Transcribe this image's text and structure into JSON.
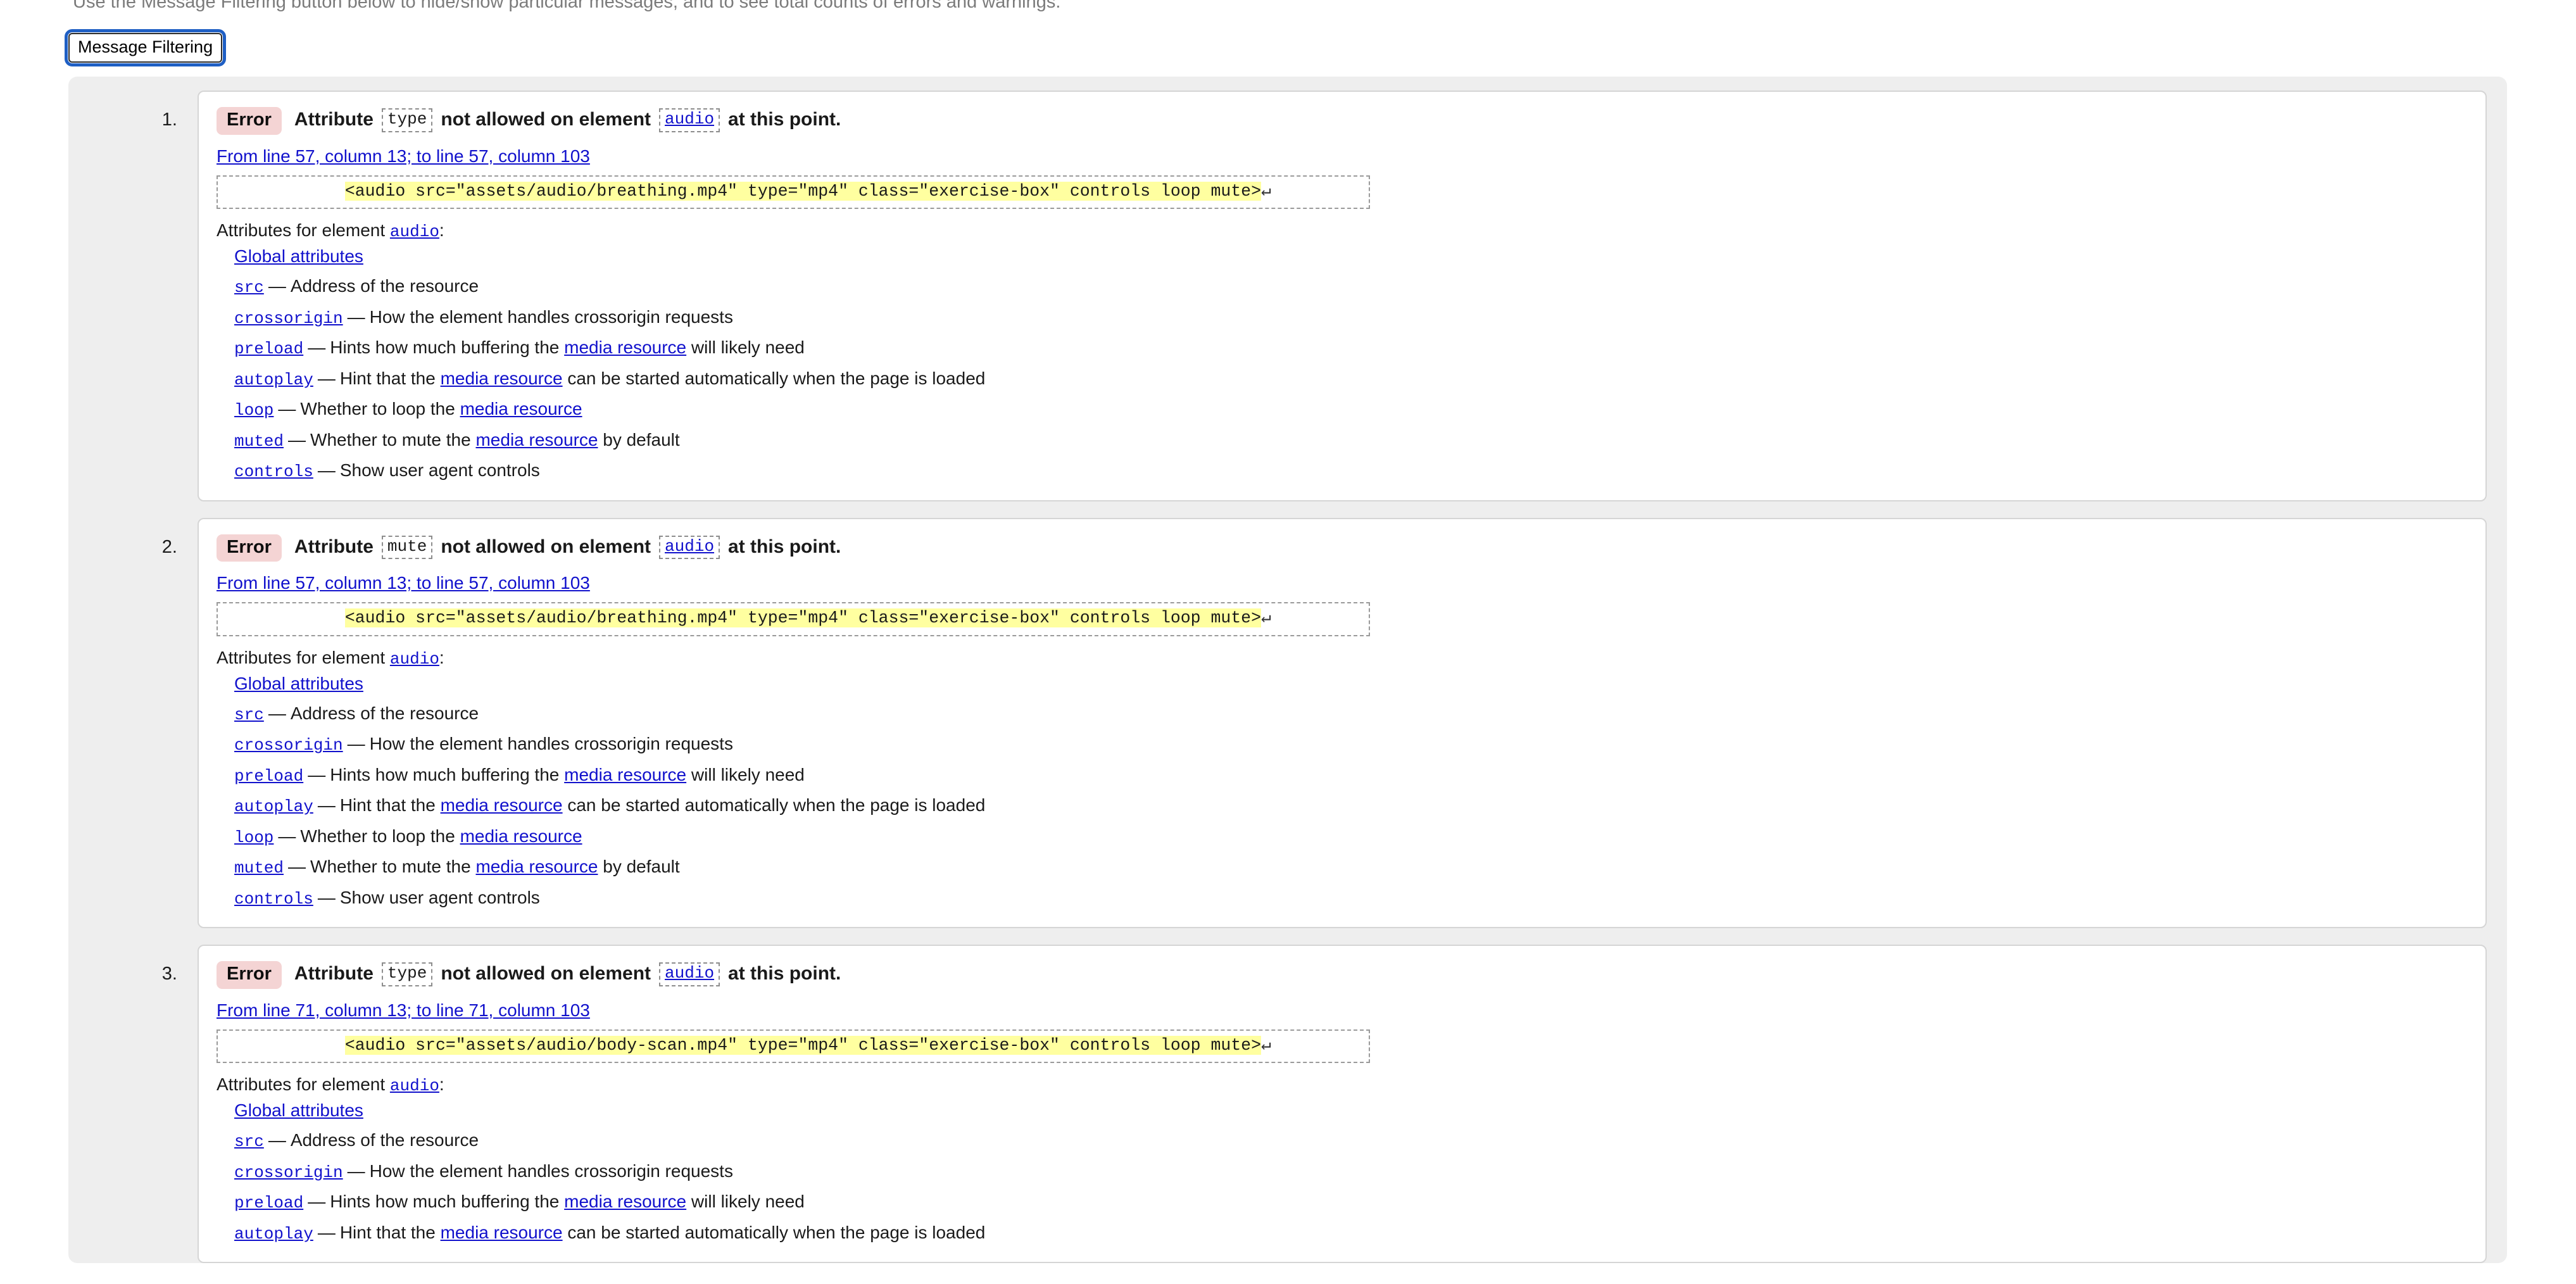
{
  "intro": {
    "text": "Use the Message Filtering button below to hide/show particular messages, and to see total counts of errors and warnings."
  },
  "toolbar": {
    "filter_button_label": "Message Filtering"
  },
  "labels": {
    "badge_error": "Error",
    "attribute_word": "Attribute",
    "not_allowed": "not allowed on element",
    "at_this_point": "at this point.",
    "attributes_for_element": "Attributes for element",
    "colon": ":",
    "dash": "—",
    "return_glyph": "↵"
  },
  "attributes_reference": {
    "global": "Global attributes",
    "items": [
      {
        "name": "src",
        "desc_before": "Address of the resource",
        "link": null,
        "desc_after": ""
      },
      {
        "name": "crossorigin",
        "desc_before": "How the element handles crossorigin requests",
        "link": null,
        "desc_after": ""
      },
      {
        "name": "preload",
        "desc_before": "Hints how much buffering the",
        "link": "media resource",
        "desc_after": "will likely need"
      },
      {
        "name": "autoplay",
        "desc_before": "Hint that the",
        "link": "media resource",
        "desc_after": "can be started automatically when the page is loaded"
      },
      {
        "name": "loop",
        "desc_before": "Whether to loop the",
        "link": "media resource",
        "desc_after": ""
      },
      {
        "name": "muted",
        "desc_before": "Whether to mute the",
        "link": "media resource",
        "desc_after": "by default"
      },
      {
        "name": "controls",
        "desc_before": "Show user agent controls",
        "link": null,
        "desc_after": ""
      }
    ]
  },
  "messages": [
    {
      "index": "1",
      "type": "Error",
      "attribute": "type",
      "element": "audio",
      "location": "From line 57, column 13; to line 57, column 103",
      "extract_indent": "            ",
      "extract_code": "<audio src=\"assets/audio/breathing.mp4\" type=\"mp4\" class=\"exercise-box\" controls loop mute>",
      "attr_count": 7
    },
    {
      "index": "2",
      "type": "Error",
      "attribute": "mute",
      "element": "audio",
      "location": "From line 57, column 13; to line 57, column 103",
      "extract_indent": "            ",
      "extract_code": "<audio src=\"assets/audio/breathing.mp4\" type=\"mp4\" class=\"exercise-box\" controls loop mute>",
      "attr_count": 7
    },
    {
      "index": "3",
      "type": "Error",
      "attribute": "type",
      "element": "audio",
      "location": "From line 71, column 13; to line 71, column 103",
      "extract_indent": "            ",
      "extract_code": "<audio src=\"assets/audio/body-scan.mp4\" type=\"mp4\" class=\"exercise-box\" controls loop mute>",
      "attr_count": 4
    }
  ],
  "colors": {
    "badge_background": "#f4d4d4",
    "highlight": "#ffffa0",
    "link": "#1111cc",
    "panel_background": "#eeeeee",
    "focus_ring": "#1f5fc4"
  }
}
